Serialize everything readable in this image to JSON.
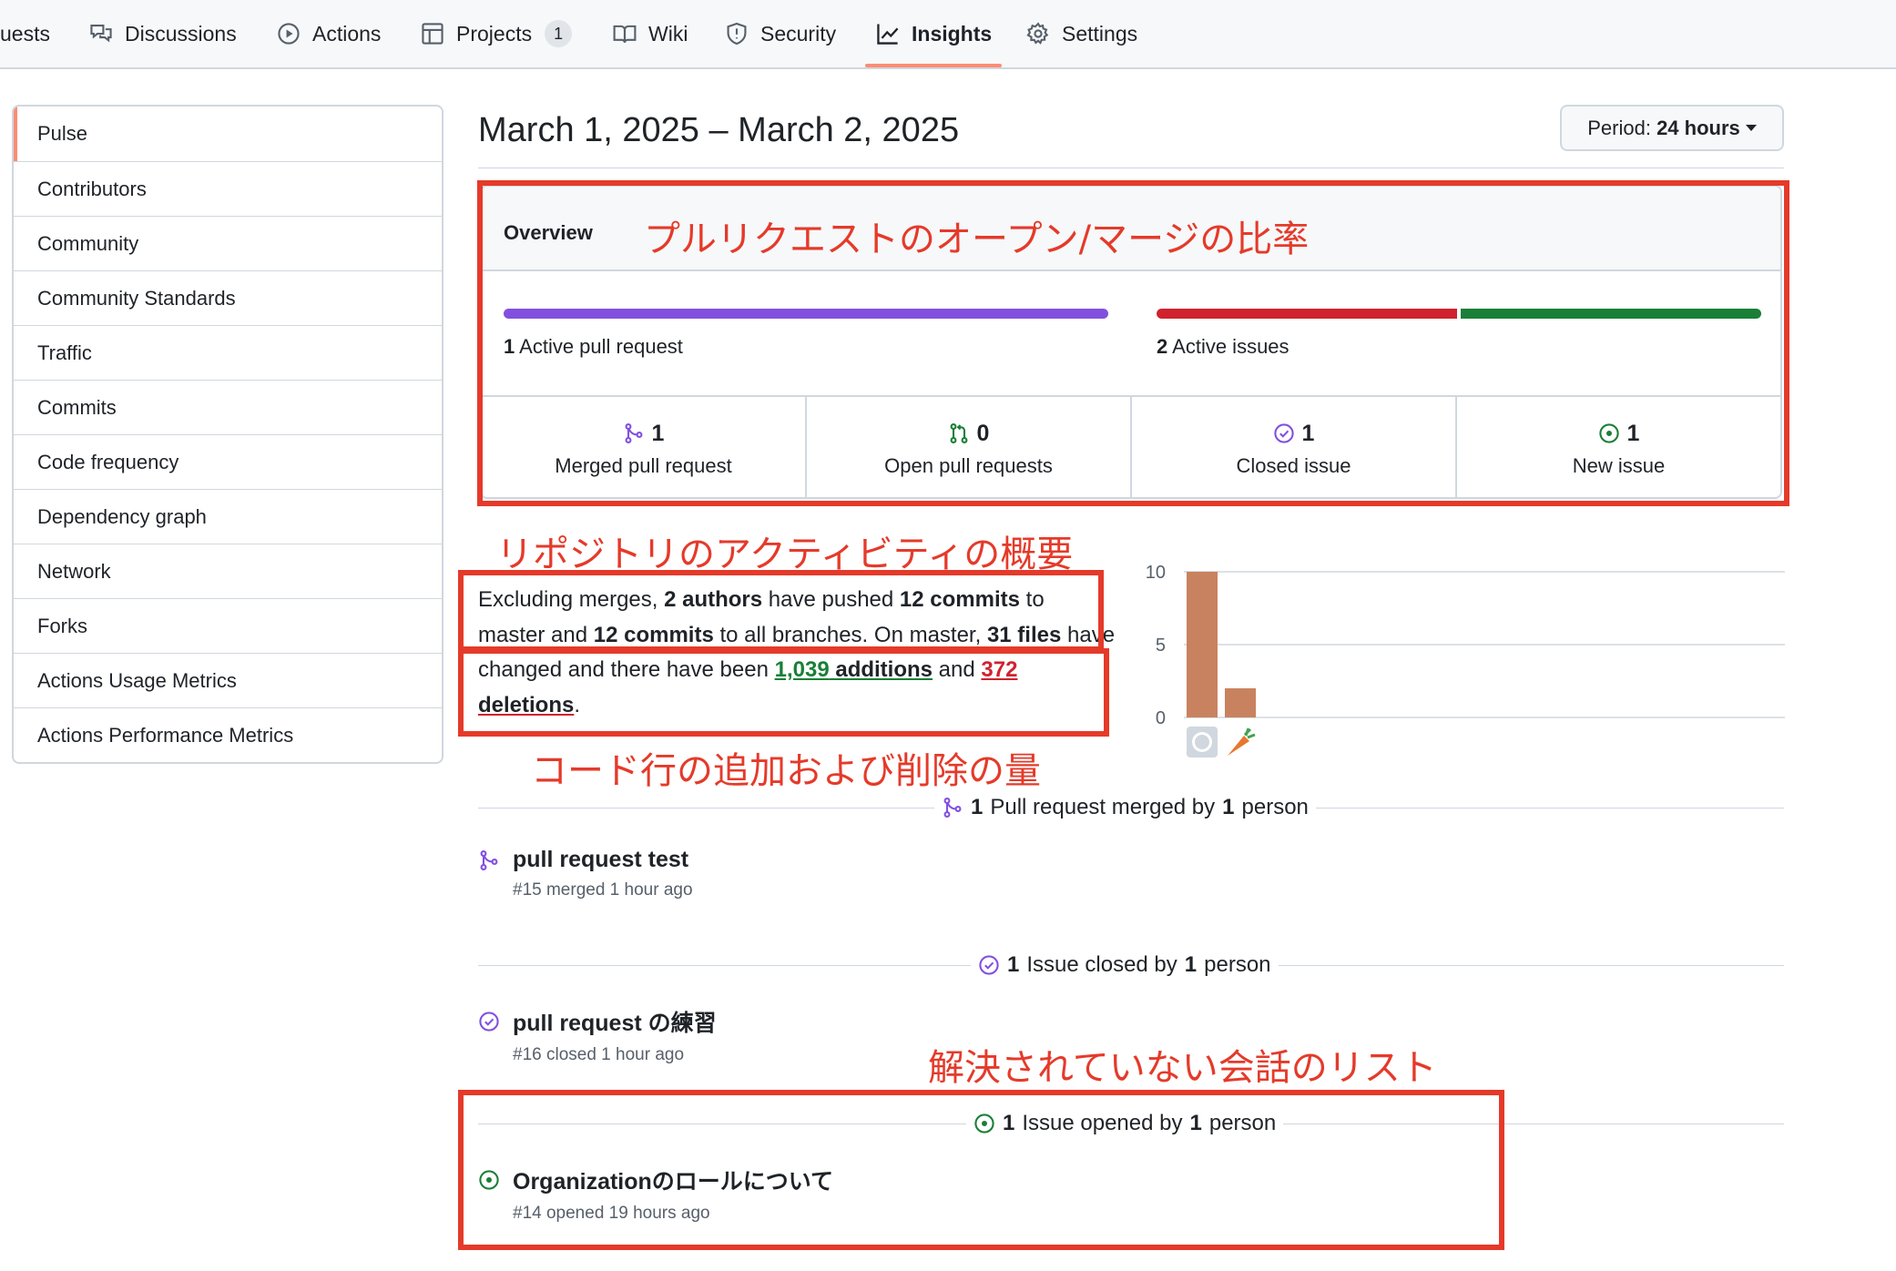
{
  "nav": {
    "items": [
      {
        "label": "uests",
        "icon": "pull-request-icon"
      },
      {
        "label": "Discussions",
        "icon": "comment-discussion-icon"
      },
      {
        "label": "Actions",
        "icon": "play-icon"
      },
      {
        "label": "Projects",
        "icon": "table-icon",
        "counter": "1"
      },
      {
        "label": "Wiki",
        "icon": "book-icon"
      },
      {
        "label": "Security",
        "icon": "shield-icon"
      },
      {
        "label": "Insights",
        "icon": "graph-icon",
        "active": true
      },
      {
        "label": "Settings",
        "icon": "gear-icon"
      }
    ]
  },
  "sidebar": {
    "items": [
      {
        "label": "Pulse",
        "selected": true
      },
      {
        "label": "Contributors"
      },
      {
        "label": "Community"
      },
      {
        "label": "Community Standards"
      },
      {
        "label": "Traffic"
      },
      {
        "label": "Commits"
      },
      {
        "label": "Code frequency"
      },
      {
        "label": "Dependency graph"
      },
      {
        "label": "Network"
      },
      {
        "label": "Forks"
      },
      {
        "label": "Actions Usage Metrics"
      },
      {
        "label": "Actions Performance Metrics"
      }
    ]
  },
  "header": {
    "date_range": "March 1, 2025 – March 2, 2025",
    "period_prefix": "Period: ",
    "period_value": "24 hours"
  },
  "overview": {
    "title": "Overview",
    "pr_bar": {
      "count": "1",
      "text": "Active pull request",
      "merged_fraction": 1.0
    },
    "issues_bar": {
      "count": "2",
      "text": "Active issues",
      "closed_fraction": 0.5,
      "open_fraction": 0.5
    },
    "stats": [
      {
        "value": "1",
        "label": "Merged pull request",
        "icon": "git-merge-icon"
      },
      {
        "value": "0",
        "label": "Open pull requests",
        "icon": "git-pull-request-icon"
      },
      {
        "value": "1",
        "label": "Closed issue",
        "icon": "issue-closed-icon"
      },
      {
        "value": "1",
        "label": "New issue",
        "icon": "issue-opened-icon"
      }
    ]
  },
  "summary": {
    "p1": "Excluding merges, ",
    "authors": "2 authors",
    "p2": " have pushed ",
    "commits_master": "12 commits",
    "p3": " to master and ",
    "commits_all": "12 commits",
    "p4": " to all branches. On master, ",
    "files": "31 files",
    "p5": " have changed and there have been ",
    "additions_num": "1,039",
    "additions_word": " additions",
    "p6": " and ",
    "deletions_num": "372",
    "deletions_word": " deletions",
    "p7": "."
  },
  "chart_data": {
    "type": "bar",
    "categories": [
      "github-avatar",
      "carrot-avatar"
    ],
    "values": [
      10,
      2
    ],
    "ylim": [
      0,
      10
    ],
    "yticks": [
      "10",
      "5",
      "0"
    ],
    "color": "#c9825f"
  },
  "sections": {
    "merged": {
      "count": "1",
      "text": "Pull request merged by",
      "count2": "1",
      "text2": "person"
    },
    "closed": {
      "count": "1",
      "text": "Issue closed by",
      "count2": "1",
      "text2": "person"
    },
    "opened": {
      "count": "1",
      "text": "Issue opened by",
      "count2": "1",
      "text2": "person"
    }
  },
  "entries": {
    "merged_pr": {
      "title": "pull request test",
      "meta": "#15 merged 1 hour ago"
    },
    "closed_issue": {
      "title": "pull request の練習",
      "meta": "#16 closed 1 hour ago"
    },
    "opened_issue": {
      "title": "Organizationのロールについて",
      "meta": "#14 opened 19 hours ago"
    }
  },
  "annotations": {
    "overview_note": "プルリクエストのオープン/マージの比率",
    "activity_note": "リポジトリのアクティビティの概要",
    "lines_note": "コード行の追加および削除の量",
    "unresolved_note": "解決されていない会話のリスト"
  },
  "colors": {
    "accent_underline": "#fd8c73",
    "merged_purple": "#8250df",
    "closed_red": "#cf222e",
    "open_green": "#1a7f37",
    "annotation_red": "#e53a2a"
  }
}
